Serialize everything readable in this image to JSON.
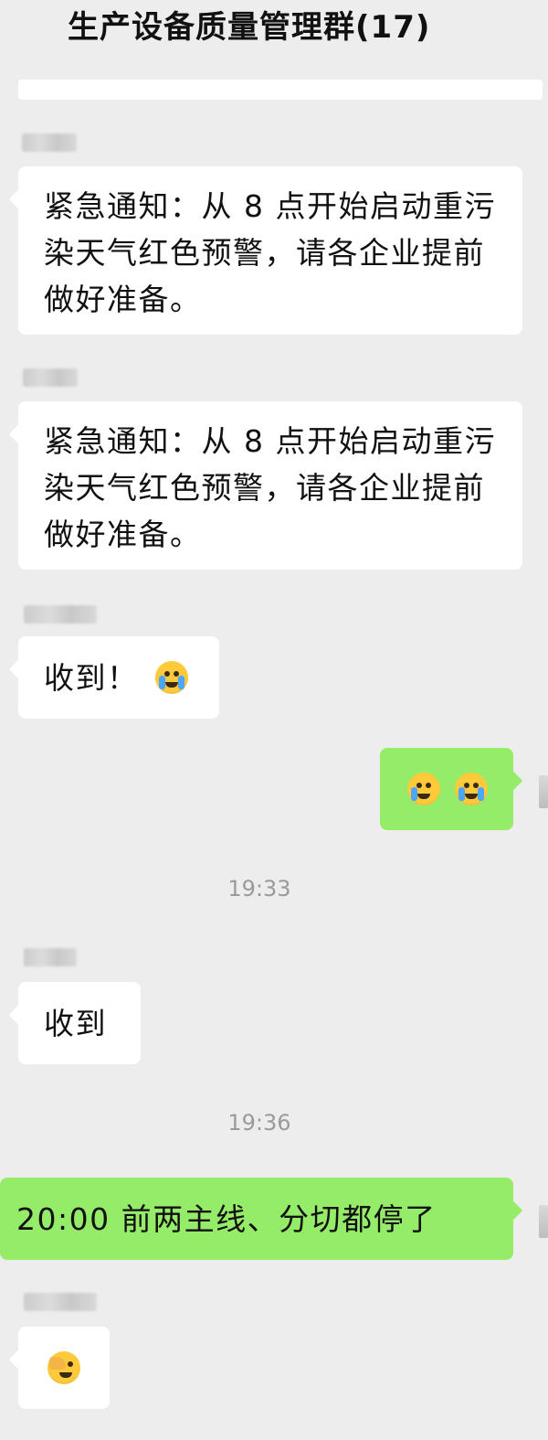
{
  "header": {
    "title": "生产设备质量管理群(17)"
  },
  "messages": [
    {
      "side": "left",
      "text": "紧急通知：从 8 点开始启动重污染天气红色预警，请各企业提前做好准备。"
    },
    {
      "side": "left",
      "text": "紧急通知：从 8 点开始启动重污染天气红色预警，请各企业提前做好准备。"
    },
    {
      "side": "left",
      "text": "收到！",
      "emoji": "crying-face"
    },
    {
      "side": "right",
      "text": "",
      "emoji": [
        "crying-face",
        "loudly-crying-face"
      ]
    },
    {
      "timestamp": "19:33"
    },
    {
      "side": "left",
      "text": "收到"
    },
    {
      "timestamp": "19:36"
    },
    {
      "side": "right",
      "text": "20:00 前两主线、分切都停了"
    },
    {
      "side": "left",
      "text": "",
      "emoji": "face-palm"
    }
  ],
  "colors": {
    "background": "#ededed",
    "incoming_bubble": "#ffffff",
    "outgoing_bubble": "#95ec69",
    "timestamp_text": "#9a9a9a"
  }
}
